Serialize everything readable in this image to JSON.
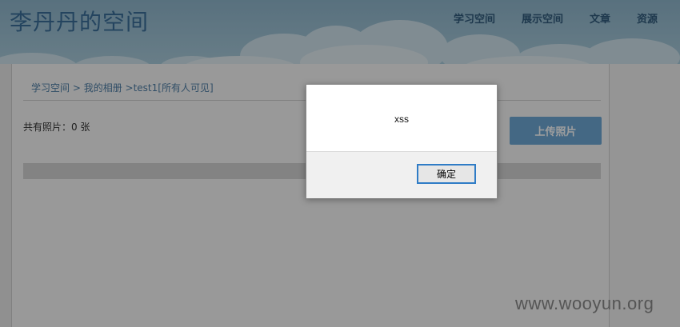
{
  "site": {
    "title": "李丹丹的空间"
  },
  "nav": {
    "items": [
      "学习空间",
      "展示空间",
      "文章",
      "资源"
    ]
  },
  "breadcrumb": {
    "items": [
      "学习空间",
      " > ",
      "我的相册",
      " >",
      "test1[所有人可见]"
    ]
  },
  "album": {
    "photo_count_text": "共有照片：0 张",
    "upload_label": "上传照片"
  },
  "dialog": {
    "message": "xss",
    "ok_label": "确定"
  },
  "watermark": {
    "text": "www.wooyun.org"
  },
  "colors": {
    "header_bg": "#9fc3d6",
    "accent": "#6ea9d6",
    "ok_border": "#2f7cc6"
  }
}
